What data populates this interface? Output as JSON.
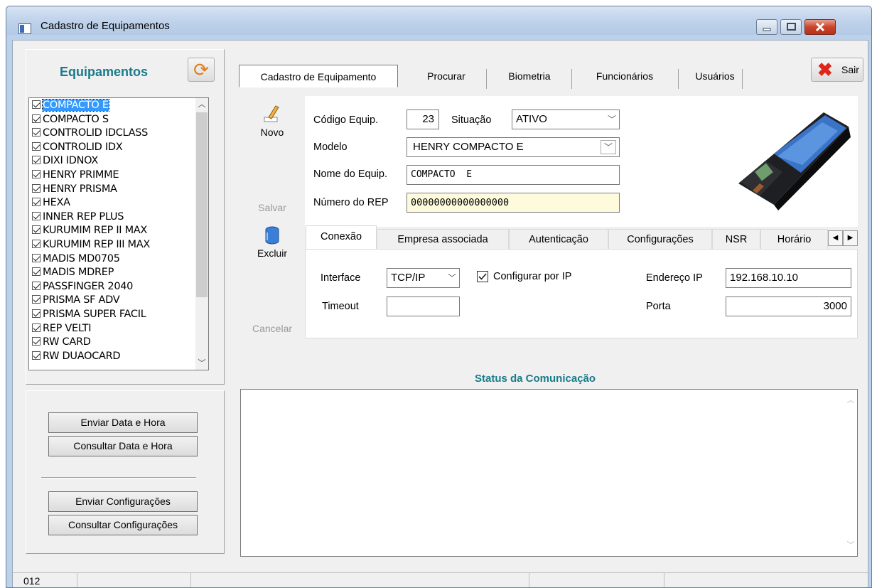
{
  "window": {
    "title": "Cadastro de Equipamentos"
  },
  "left": {
    "title": "Equipamentos",
    "items": [
      {
        "label": "COMPACTO E",
        "selected": true
      },
      {
        "label": "COMPACTO S"
      },
      {
        "label": "CONTROLID IDCLASS"
      },
      {
        "label": "CONTROLID IDX"
      },
      {
        "label": "DIXI IDNOX"
      },
      {
        "label": "HENRY PRIMME"
      },
      {
        "label": "HENRY PRISMA"
      },
      {
        "label": "HEXA"
      },
      {
        "label": "INNER REP PLUS"
      },
      {
        "label": "KURUMIM REP II MAX"
      },
      {
        "label": "KURUMIM REP III MAX"
      },
      {
        "label": "MADIS MD0705"
      },
      {
        "label": "MADIS MDREP"
      },
      {
        "label": "PASSFINGER 2040"
      },
      {
        "label": "PRISMA SF ADV"
      },
      {
        "label": "PRISMA SUPER FACIL"
      },
      {
        "label": "REP VELTI"
      },
      {
        "label": "RW CARD"
      },
      {
        "label": "RW DUAOCARD"
      }
    ],
    "btn_send_date": "Enviar Data e Hora",
    "btn_query_date": "Consultar Data e Hora",
    "btn_send_cfg": "Enviar Configurações",
    "btn_query_cfg": "Consultar Configurações"
  },
  "tabs": [
    "Cadastro de Equipamento",
    "Procurar",
    "Biometria",
    "Funcionários",
    "Usuários"
  ],
  "sair": "Sair",
  "actions": {
    "novo": "Novo",
    "salvar": "Salvar",
    "excluir": "Excluir",
    "cancelar": "Cancelar"
  },
  "form": {
    "codigo_label": "Código Equip.",
    "codigo_value": "23",
    "situacao_label": "Situação",
    "situacao_value": "ATIVO",
    "modelo_label": "Modelo",
    "modelo_value": "HENRY COMPACTO E",
    "nome_label": "Nome do Equip.",
    "nome_value": "COMPACTO  E",
    "rep_label": "Número do REP",
    "rep_value": "00000000000000000"
  },
  "inner_tabs": [
    "Conexão",
    "Empresa associada",
    "Autenticação",
    "Configurações",
    "NSR",
    "Horário"
  ],
  "connection": {
    "interface_label": "Interface",
    "interface_value": "TCP/IP",
    "configurar_ip": "Configurar por IP",
    "configurar_ip_checked": true,
    "timeout_label": "Timeout",
    "timeout_value": "",
    "ip_label": "Endereço IP",
    "ip_value": "192.168.10.10",
    "porta_label": "Porta",
    "porta_value": "3000"
  },
  "status": {
    "title": "Status da Comunicação"
  },
  "statusbar": {
    "text": "012"
  },
  "colors": {
    "accent_title": "#1a7a8a",
    "selection": "#3399ff",
    "rep_field_bg": "#fefbdc",
    "close_red": "#c8452c"
  }
}
